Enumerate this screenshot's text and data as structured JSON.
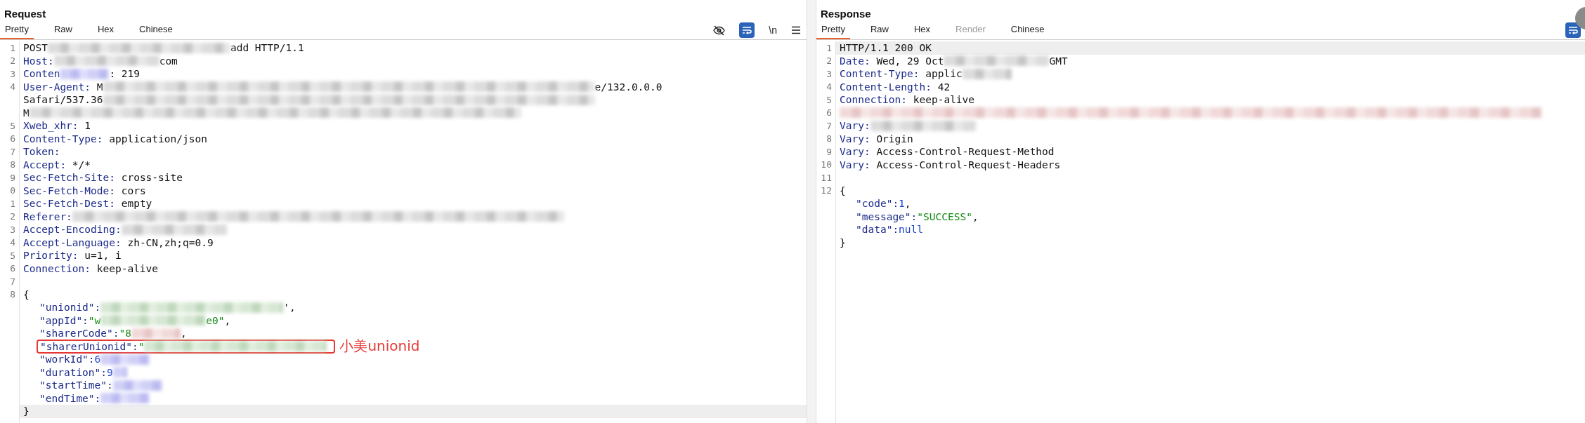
{
  "request": {
    "title": "Request",
    "tabs": [
      {
        "label": "Pretty",
        "selected": true,
        "disabled": false
      },
      {
        "label": "Raw",
        "selected": false,
        "disabled": false
      },
      {
        "label": "Hex",
        "selected": false,
        "disabled": false
      },
      {
        "label": "Chinese",
        "selected": false,
        "disabled": false
      }
    ],
    "toolbar": [
      {
        "kind": "hide"
      },
      {
        "kind": "wrap"
      },
      {
        "kind": "text",
        "label": "\\n"
      },
      {
        "kind": "menu"
      }
    ],
    "lines": [
      {
        "number": "1",
        "segments": [
          {
            "kind": "plain",
            "text": "POST"
          },
          {
            "kind": "blur"
          },
          {
            "kind": "plain",
            "text": "add HTTP/1.1"
          }
        ]
      },
      {
        "number": "2",
        "segments": [
          {
            "kind": "header",
            "text": "Host:"
          },
          {
            "kind": "blur"
          },
          {
            "kind": "plain",
            "text": "com"
          }
        ]
      },
      {
        "number": "3",
        "segments": [
          {
            "kind": "header",
            "text": "Conten"
          },
          {
            "kind": "blur"
          },
          {
            "kind": "plain",
            "text": ": 219"
          }
        ]
      },
      {
        "number": "4",
        "segments": [
          {
            "kind": "header",
            "text": "User-Agent:"
          },
          {
            "kind": "plain",
            "text": "M"
          },
          {
            "kind": "blur"
          },
          {
            "kind": "plain",
            "text": "e/132.0.0.0"
          }
        ]
      },
      {
        "segments": [
          {
            "kind": "plain",
            "text": "Safari/537.36"
          },
          {
            "kind": "blur"
          }
        ]
      },
      {
        "segments": [
          {
            "kind": "plain",
            "text": "M"
          },
          {
            "kind": "blur"
          }
        ]
      },
      {
        "number": "5",
        "segments": [
          {
            "kind": "header",
            "text": "Xweb_xhr:"
          },
          {
            "kind": "plain",
            "text": "1"
          }
        ]
      },
      {
        "number": "6",
        "segments": [
          {
            "kind": "header",
            "text": "Content-Type:"
          },
          {
            "kind": "plain",
            "text": "application/json"
          }
        ]
      },
      {
        "number": "7",
        "segments": [
          {
            "kind": "header",
            "text": "Token:"
          }
        ]
      },
      {
        "number": "8",
        "segments": [
          {
            "kind": "header",
            "text": "Accept:"
          },
          {
            "kind": "plain",
            "text": "*/*"
          }
        ]
      },
      {
        "number": "9",
        "segments": [
          {
            "kind": "header",
            "text": "Sec-Fetch-Site:"
          },
          {
            "kind": "plain",
            "text": "cross-site"
          }
        ]
      },
      {
        "number": "0",
        "segments": [
          {
            "kind": "header",
            "text": "Sec-Fetch-Mode:"
          },
          {
            "kind": "plain",
            "text": "cors"
          }
        ]
      },
      {
        "number": "1",
        "segments": [
          {
            "kind": "header",
            "text": "Sec-Fetch-Dest:"
          },
          {
            "kind": "plain",
            "text": "empty"
          }
        ]
      },
      {
        "number": "2",
        "segments": [
          {
            "kind": "header",
            "text": "Referer:"
          },
          {
            "kind": "blur"
          }
        ]
      },
      {
        "number": "3",
        "segments": [
          {
            "kind": "header",
            "text": "Accept-Encoding:"
          },
          {
            "kind": "blur"
          }
        ]
      },
      {
        "number": "4",
        "segments": [
          {
            "kind": "header",
            "text": "Accept-Language:"
          },
          {
            "kind": "plain",
            "text": "zh-CN,zh;q=0.9"
          }
        ]
      },
      {
        "number": "5",
        "segments": [
          {
            "kind": "header",
            "text": "Priority:"
          },
          {
            "kind": "plain",
            "text": "u=1, i"
          }
        ]
      },
      {
        "number": "6",
        "segments": [
          {
            "kind": "header",
            "text": "Connection:"
          },
          {
            "kind": "plain",
            "text": "keep-alive"
          }
        ]
      },
      {
        "number": "7"
      },
      {
        "number": "8",
        "segments": [
          {
            "kind": "plain",
            "text": "{"
          }
        ]
      },
      {
        "indented": true,
        "segments": [
          {
            "kind": "key",
            "text": "\"unionid\":"
          },
          {
            "kind": "blur"
          },
          {
            "kind": "plain",
            "text": "',"
          }
        ]
      },
      {
        "indented": true,
        "segments": [
          {
            "kind": "key",
            "text": "\"appId\":"
          },
          {
            "kind": "string",
            "text": "\"w"
          },
          {
            "kind": "blur"
          },
          {
            "kind": "string",
            "text": "e0\""
          },
          {
            "kind": "plain",
            "text": ","
          }
        ]
      },
      {
        "indented": true,
        "segments": [
          {
            "kind": "key",
            "text": "\"sharerCode\":"
          },
          {
            "kind": "string",
            "text": "\"8"
          },
          {
            "kind": "blur"
          },
          {
            "kind": "plain",
            "text": ","
          }
        ]
      },
      {
        "indented": true,
        "boxed": true,
        "annotation": "小美unionid",
        "segments": [
          {
            "kind": "key",
            "text": "\"sharerUnionid\":"
          },
          {
            "kind": "string",
            "text": "\""
          },
          {
            "kind": "blur"
          }
        ]
      },
      {
        "indented": true,
        "segments": [
          {
            "kind": "key",
            "text": "\"workId\":"
          },
          {
            "kind": "number",
            "text": "6"
          },
          {
            "kind": "blur"
          }
        ]
      },
      {
        "indented": true,
        "segments": [
          {
            "kind": "key",
            "text": "\"duration\":"
          },
          {
            "kind": "number",
            "text": "9"
          },
          {
            "kind": "blur"
          }
        ]
      },
      {
        "indented": true,
        "segments": [
          {
            "kind": "key",
            "text": "\"startTime\":"
          },
          {
            "kind": "blur"
          }
        ]
      },
      {
        "indented": true,
        "segments": [
          {
            "kind": "key",
            "text": "\"endTime\":"
          },
          {
            "kind": "blur"
          }
        ]
      },
      {
        "highlighted": true,
        "segments": [
          {
            "kind": "plain",
            "text": "}"
          }
        ]
      }
    ]
  },
  "response": {
    "title": "Response",
    "tabs": [
      {
        "label": "Pretty",
        "selected": true,
        "disabled": false
      },
      {
        "label": "Raw",
        "selected": false,
        "disabled": false
      },
      {
        "label": "Hex",
        "selected": false,
        "disabled": false
      },
      {
        "label": "Render",
        "selected": false,
        "disabled": true
      },
      {
        "label": "Chinese",
        "selected": false,
        "disabled": false
      }
    ],
    "toolbar": [
      {
        "kind": "wrap"
      }
    ],
    "lines": [
      {
        "number": "1",
        "highlighted": true,
        "segments": [
          {
            "kind": "plain",
            "text": "HTTP/1.1 200 OK"
          }
        ]
      },
      {
        "number": "2",
        "segments": [
          {
            "kind": "header",
            "text": "Date:"
          },
          {
            "kind": "plain",
            "text": "Wed, 29 Oct"
          },
          {
            "kind": "blur"
          },
          {
            "kind": "plain",
            "text": "GMT"
          }
        ]
      },
      {
        "number": "3",
        "segments": [
          {
            "kind": "header",
            "text": "Content-Type:"
          },
          {
            "kind": "plain",
            "text": "applic"
          },
          {
            "kind": "blur"
          }
        ]
      },
      {
        "number": "4",
        "segments": [
          {
            "kind": "header",
            "text": "Content-Length:"
          },
          {
            "kind": "plain",
            "text": "42"
          }
        ]
      },
      {
        "number": "5",
        "segments": [
          {
            "kind": "header",
            "text": "Connection:"
          },
          {
            "kind": "plain",
            "text": "keep-alive"
          }
        ]
      },
      {
        "number": "6",
        "segments": [
          {
            "kind": "blur"
          }
        ]
      },
      {
        "number": "7",
        "segments": [
          {
            "kind": "header",
            "text": "Vary:"
          },
          {
            "kind": "blur"
          }
        ]
      },
      {
        "number": "8",
        "segments": [
          {
            "kind": "header",
            "text": "Vary:"
          },
          {
            "kind": "plain",
            "text": "Origin"
          }
        ]
      },
      {
        "number": "9",
        "segments": [
          {
            "kind": "header",
            "text": "Vary:"
          },
          {
            "kind": "plain",
            "text": "Access-Control-Request-Method"
          }
        ]
      },
      {
        "number": "10",
        "segments": [
          {
            "kind": "header",
            "text": "Vary:"
          },
          {
            "kind": "plain",
            "text": "Access-Control-Request-Headers"
          }
        ]
      },
      {
        "number": "11"
      },
      {
        "number": "12",
        "segments": [
          {
            "kind": "plain",
            "text": "{"
          }
        ]
      },
      {
        "indented": true,
        "segments": [
          {
            "kind": "key",
            "text": "\"code\":"
          },
          {
            "kind": "number",
            "text": "1"
          },
          {
            "kind": "plain",
            "text": ","
          }
        ]
      },
      {
        "indented": true,
        "segments": [
          {
            "kind": "key",
            "text": "\"message\":"
          },
          {
            "kind": "string",
            "text": "\"SUCCESS\""
          },
          {
            "kind": "plain",
            "text": ","
          }
        ]
      },
      {
        "indented": true,
        "segments": [
          {
            "kind": "key",
            "text": "\"data\":"
          },
          {
            "kind": "number",
            "text": "null"
          }
        ]
      },
      {
        "segments": [
          {
            "kind": "plain",
            "text": "}"
          }
        ]
      }
    ]
  }
}
